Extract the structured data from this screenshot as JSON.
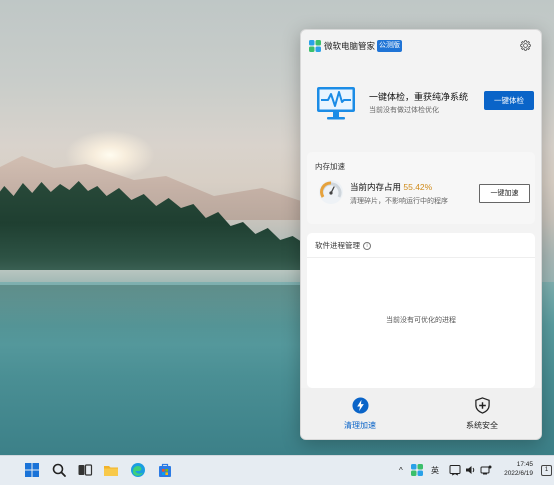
{
  "app": {
    "name": "微软电脑管家",
    "badge": "公测版",
    "logo_icon": "four-leaf-logo-icon",
    "settings_icon": "gear-icon"
  },
  "checkup": {
    "title": "一键体检，重获纯净系统",
    "subtitle": "当前没有做过体检优化",
    "button": "一键体检",
    "icon": "monitor-pulse-icon"
  },
  "memory": {
    "section_title": "内存加速",
    "label": "当前内存占用",
    "value": "55.42%",
    "value_fraction": 0.5542,
    "subtitle": "清理碎片，不影响运行中的程序",
    "button": "一键加速",
    "icon": "speedometer-icon"
  },
  "process": {
    "section_title": "软件进程管理",
    "info_icon": "info-icon",
    "empty_text": "当前没有可优化的进程"
  },
  "nav": [
    {
      "label": "清理加速",
      "icon": "lightning-icon",
      "active": true
    },
    {
      "label": "系统安全",
      "icon": "shield-plus-icon",
      "active": false
    }
  ],
  "taskbar": {
    "icons": [
      "start-icon",
      "search-icon",
      "task-view-icon",
      "file-explorer-icon",
      "edge-icon",
      "store-icon"
    ],
    "tray": {
      "chevron": "^",
      "lang": "英",
      "time": "17:45",
      "date": "2022/6/19",
      "notifications": "1"
    }
  },
  "colors": {
    "accent": "#0a64c8",
    "memory_value": "#d08b1a",
    "badge": "#1f74d6"
  }
}
